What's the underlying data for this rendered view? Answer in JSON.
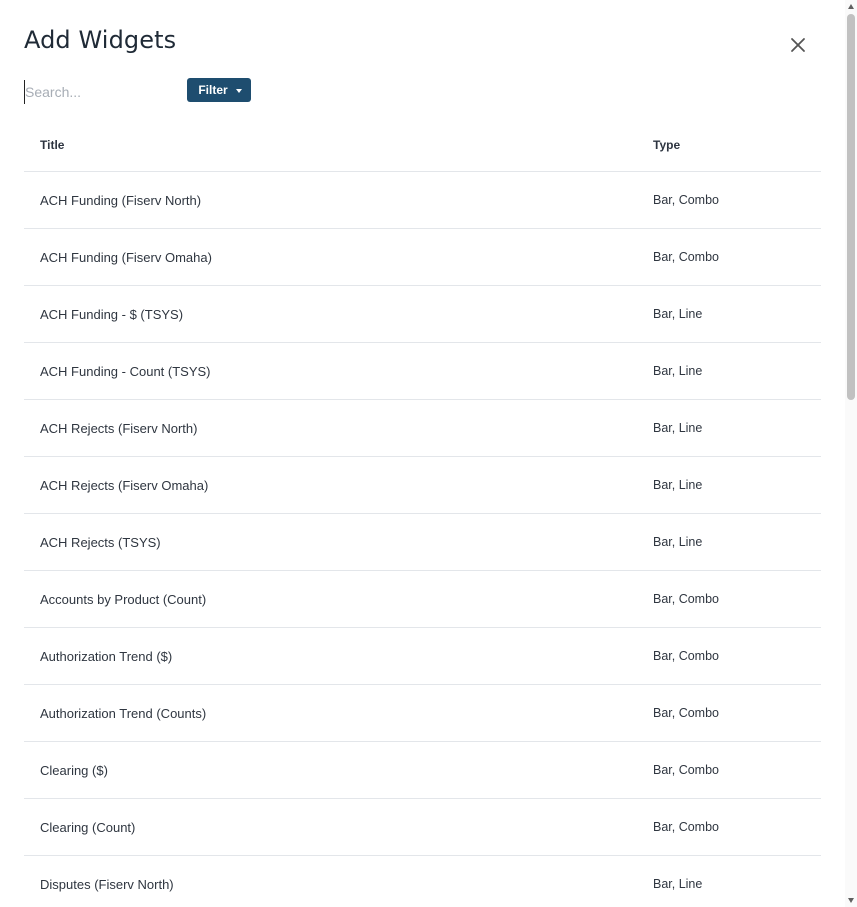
{
  "dialog": {
    "title": "Add Widgets",
    "close_icon": "close-icon"
  },
  "search": {
    "placeholder": "Search...",
    "value": ""
  },
  "filter": {
    "label": "Filter",
    "icon": "caret-down-icon",
    "color": "#1e4d6f"
  },
  "table": {
    "headers": {
      "title": "Title",
      "type": "Type"
    },
    "rows": [
      {
        "title": "ACH Funding (Fiserv North)",
        "type": "Bar, Combo"
      },
      {
        "title": "ACH Funding (Fiserv Omaha)",
        "type": "Bar, Combo"
      },
      {
        "title": "ACH Funding - $ (TSYS)",
        "type": "Bar, Line"
      },
      {
        "title": "ACH Funding - Count (TSYS)",
        "type": "Bar, Line"
      },
      {
        "title": "ACH Rejects (Fiserv North)",
        "type": "Bar, Line"
      },
      {
        "title": "ACH Rejects (Fiserv Omaha)",
        "type": "Bar, Line"
      },
      {
        "title": "ACH Rejects (TSYS)",
        "type": "Bar, Line"
      },
      {
        "title": "Accounts by Product (Count)",
        "type": "Bar, Combo"
      },
      {
        "title": "Authorization Trend ($)",
        "type": "Bar, Combo"
      },
      {
        "title": "Authorization Trend (Counts)",
        "type": "Bar, Combo"
      },
      {
        "title": "Clearing ($)",
        "type": "Bar, Combo"
      },
      {
        "title": "Clearing (Count)",
        "type": "Bar, Combo"
      },
      {
        "title": "Disputes (Fiserv North)",
        "type": "Bar, Line"
      }
    ]
  }
}
